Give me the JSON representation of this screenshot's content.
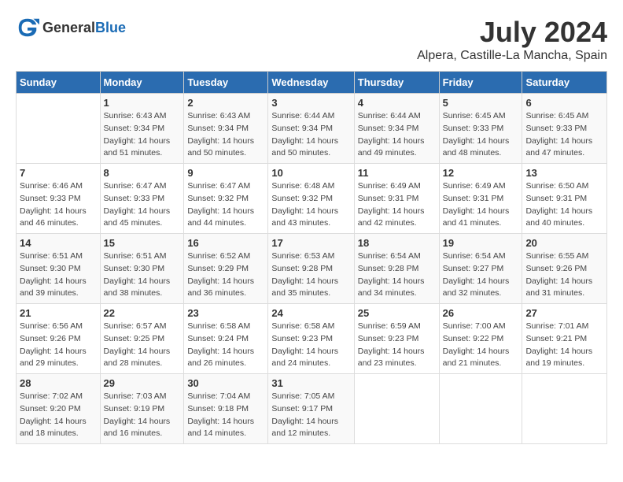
{
  "header": {
    "logo_general": "General",
    "logo_blue": "Blue",
    "title": "July 2024",
    "subtitle": "Alpera, Castille-La Mancha, Spain"
  },
  "days_of_week": [
    "Sunday",
    "Monday",
    "Tuesday",
    "Wednesday",
    "Thursday",
    "Friday",
    "Saturday"
  ],
  "weeks": [
    [
      {
        "day": "",
        "sunrise": "",
        "sunset": "",
        "daylight": ""
      },
      {
        "day": "1",
        "sunrise": "Sunrise: 6:43 AM",
        "sunset": "Sunset: 9:34 PM",
        "daylight": "Daylight: 14 hours and 51 minutes."
      },
      {
        "day": "2",
        "sunrise": "Sunrise: 6:43 AM",
        "sunset": "Sunset: 9:34 PM",
        "daylight": "Daylight: 14 hours and 50 minutes."
      },
      {
        "day": "3",
        "sunrise": "Sunrise: 6:44 AM",
        "sunset": "Sunset: 9:34 PM",
        "daylight": "Daylight: 14 hours and 50 minutes."
      },
      {
        "day": "4",
        "sunrise": "Sunrise: 6:44 AM",
        "sunset": "Sunset: 9:34 PM",
        "daylight": "Daylight: 14 hours and 49 minutes."
      },
      {
        "day": "5",
        "sunrise": "Sunrise: 6:45 AM",
        "sunset": "Sunset: 9:33 PM",
        "daylight": "Daylight: 14 hours and 48 minutes."
      },
      {
        "day": "6",
        "sunrise": "Sunrise: 6:45 AM",
        "sunset": "Sunset: 9:33 PM",
        "daylight": "Daylight: 14 hours and 47 minutes."
      }
    ],
    [
      {
        "day": "7",
        "sunrise": "Sunrise: 6:46 AM",
        "sunset": "Sunset: 9:33 PM",
        "daylight": "Daylight: 14 hours and 46 minutes."
      },
      {
        "day": "8",
        "sunrise": "Sunrise: 6:47 AM",
        "sunset": "Sunset: 9:33 PM",
        "daylight": "Daylight: 14 hours and 45 minutes."
      },
      {
        "day": "9",
        "sunrise": "Sunrise: 6:47 AM",
        "sunset": "Sunset: 9:32 PM",
        "daylight": "Daylight: 14 hours and 44 minutes."
      },
      {
        "day": "10",
        "sunrise": "Sunrise: 6:48 AM",
        "sunset": "Sunset: 9:32 PM",
        "daylight": "Daylight: 14 hours and 43 minutes."
      },
      {
        "day": "11",
        "sunrise": "Sunrise: 6:49 AM",
        "sunset": "Sunset: 9:31 PM",
        "daylight": "Daylight: 14 hours and 42 minutes."
      },
      {
        "day": "12",
        "sunrise": "Sunrise: 6:49 AM",
        "sunset": "Sunset: 9:31 PM",
        "daylight": "Daylight: 14 hours and 41 minutes."
      },
      {
        "day": "13",
        "sunrise": "Sunrise: 6:50 AM",
        "sunset": "Sunset: 9:31 PM",
        "daylight": "Daylight: 14 hours and 40 minutes."
      }
    ],
    [
      {
        "day": "14",
        "sunrise": "Sunrise: 6:51 AM",
        "sunset": "Sunset: 9:30 PM",
        "daylight": "Daylight: 14 hours and 39 minutes."
      },
      {
        "day": "15",
        "sunrise": "Sunrise: 6:51 AM",
        "sunset": "Sunset: 9:30 PM",
        "daylight": "Daylight: 14 hours and 38 minutes."
      },
      {
        "day": "16",
        "sunrise": "Sunrise: 6:52 AM",
        "sunset": "Sunset: 9:29 PM",
        "daylight": "Daylight: 14 hours and 36 minutes."
      },
      {
        "day": "17",
        "sunrise": "Sunrise: 6:53 AM",
        "sunset": "Sunset: 9:28 PM",
        "daylight": "Daylight: 14 hours and 35 minutes."
      },
      {
        "day": "18",
        "sunrise": "Sunrise: 6:54 AM",
        "sunset": "Sunset: 9:28 PM",
        "daylight": "Daylight: 14 hours and 34 minutes."
      },
      {
        "day": "19",
        "sunrise": "Sunrise: 6:54 AM",
        "sunset": "Sunset: 9:27 PM",
        "daylight": "Daylight: 14 hours and 32 minutes."
      },
      {
        "day": "20",
        "sunrise": "Sunrise: 6:55 AM",
        "sunset": "Sunset: 9:26 PM",
        "daylight": "Daylight: 14 hours and 31 minutes."
      }
    ],
    [
      {
        "day": "21",
        "sunrise": "Sunrise: 6:56 AM",
        "sunset": "Sunset: 9:26 PM",
        "daylight": "Daylight: 14 hours and 29 minutes."
      },
      {
        "day": "22",
        "sunrise": "Sunrise: 6:57 AM",
        "sunset": "Sunset: 9:25 PM",
        "daylight": "Daylight: 14 hours and 28 minutes."
      },
      {
        "day": "23",
        "sunrise": "Sunrise: 6:58 AM",
        "sunset": "Sunset: 9:24 PM",
        "daylight": "Daylight: 14 hours and 26 minutes."
      },
      {
        "day": "24",
        "sunrise": "Sunrise: 6:58 AM",
        "sunset": "Sunset: 9:23 PM",
        "daylight": "Daylight: 14 hours and 24 minutes."
      },
      {
        "day": "25",
        "sunrise": "Sunrise: 6:59 AM",
        "sunset": "Sunset: 9:23 PM",
        "daylight": "Daylight: 14 hours and 23 minutes."
      },
      {
        "day": "26",
        "sunrise": "Sunrise: 7:00 AM",
        "sunset": "Sunset: 9:22 PM",
        "daylight": "Daylight: 14 hours and 21 minutes."
      },
      {
        "day": "27",
        "sunrise": "Sunrise: 7:01 AM",
        "sunset": "Sunset: 9:21 PM",
        "daylight": "Daylight: 14 hours and 19 minutes."
      }
    ],
    [
      {
        "day": "28",
        "sunrise": "Sunrise: 7:02 AM",
        "sunset": "Sunset: 9:20 PM",
        "daylight": "Daylight: 14 hours and 18 minutes."
      },
      {
        "day": "29",
        "sunrise": "Sunrise: 7:03 AM",
        "sunset": "Sunset: 9:19 PM",
        "daylight": "Daylight: 14 hours and 16 minutes."
      },
      {
        "day": "30",
        "sunrise": "Sunrise: 7:04 AM",
        "sunset": "Sunset: 9:18 PM",
        "daylight": "Daylight: 14 hours and 14 minutes."
      },
      {
        "day": "31",
        "sunrise": "Sunrise: 7:05 AM",
        "sunset": "Sunset: 9:17 PM",
        "daylight": "Daylight: 14 hours and 12 minutes."
      },
      {
        "day": "",
        "sunrise": "",
        "sunset": "",
        "daylight": ""
      },
      {
        "day": "",
        "sunrise": "",
        "sunset": "",
        "daylight": ""
      },
      {
        "day": "",
        "sunrise": "",
        "sunset": "",
        "daylight": ""
      }
    ]
  ]
}
